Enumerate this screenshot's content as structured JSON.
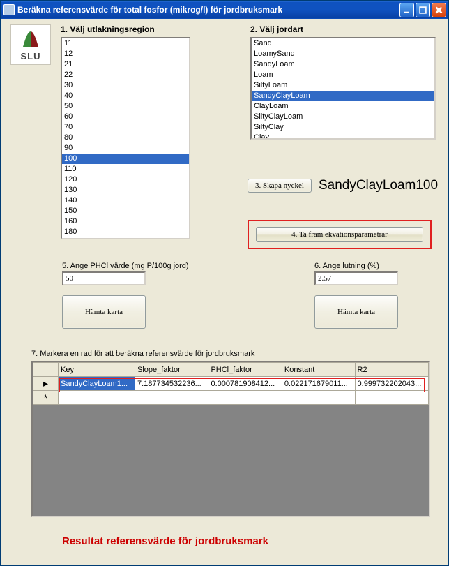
{
  "window": {
    "title": "Beräkna referensvärde för total fosfor (mikrog/l) för jordbruksmark"
  },
  "logo_text": "SLU",
  "step1": {
    "label": "1. Välj utlakningsregion",
    "items": [
      "11",
      "12",
      "21",
      "22",
      "30",
      "40",
      "50",
      "60",
      "70",
      "80",
      "90",
      "100",
      "110",
      "120",
      "130",
      "140",
      "150",
      "160",
      "180"
    ],
    "selected_index": 11
  },
  "step2": {
    "label": "2. Välj jordart",
    "items": [
      "Sand",
      "LoamySand",
      "SandyLoam",
      "Loam",
      "SiltyLoam",
      "SandyClayLoam",
      "ClayLoam",
      "SiltyClayLoam",
      "SiltyClay",
      "Clay"
    ],
    "selected_index": 5
  },
  "step3": {
    "button": "3. Skapa nyckel",
    "key": "SandyClayLoam100"
  },
  "step4": {
    "button": "4. Ta fram ekvationsparametrar"
  },
  "step5": {
    "label": "5. Ange PHCl värde (mg P/100g jord)",
    "value": "50",
    "map_button": "Hämta karta"
  },
  "step6": {
    "label": "6. Ange lutning (%)",
    "value": "2.57",
    "map_button": "Hämta karta"
  },
  "step7": {
    "label": "7. Markera en rad för att beräkna referensvärde för jordbruksmark",
    "columns": [
      "Key",
      "Slope_faktor",
      "PHCl_faktor",
      "Konstant",
      "R2"
    ],
    "rows": [
      {
        "key": "SandyClayLoam1...",
        "slope": "7.187734532236...",
        "phcl": "0.000781908412...",
        "konst": "0.022171679011...",
        "r2": "0.999732202043..."
      }
    ]
  },
  "result": {
    "label": "Resultat referensvärde för jordbruksmark"
  }
}
